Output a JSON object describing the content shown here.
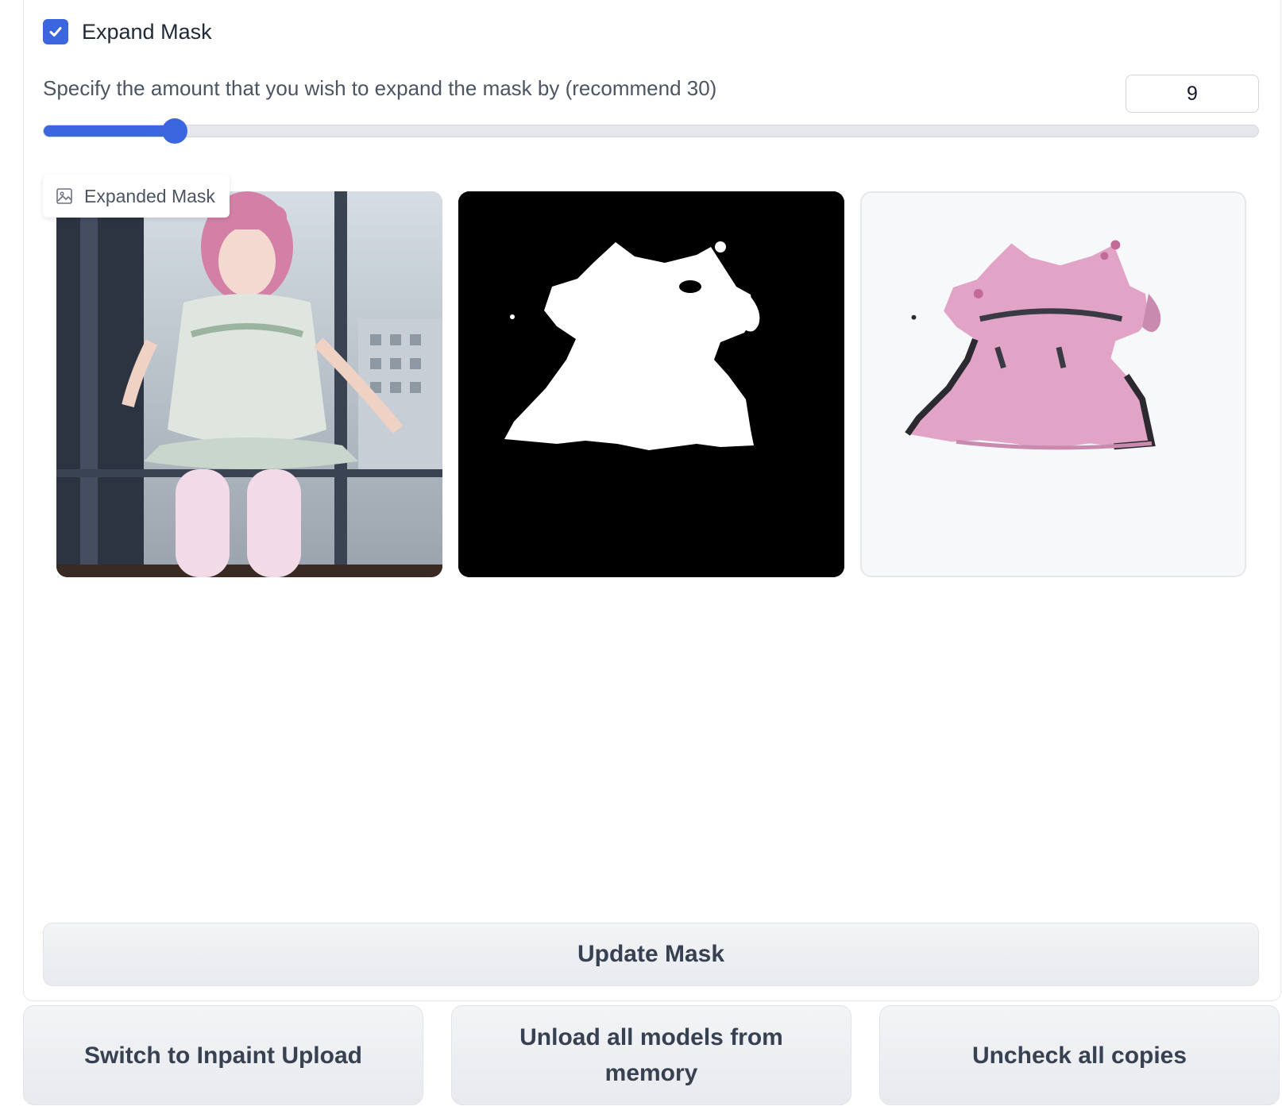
{
  "expand_mask": {
    "checkbox_label": "Expand Mask",
    "checked": true
  },
  "slider": {
    "label": "Specify the amount that you wish to expand the mask by (recommend 30)",
    "value": "9",
    "min": 0,
    "max": 100,
    "fill_fraction": 0.098
  },
  "gallery": {
    "label": "Expanded Mask",
    "items": [
      {
        "description_icon": "photo-original"
      },
      {
        "description_icon": "photo-mask"
      },
      {
        "description_icon": "photo-masked-dress"
      }
    ]
  },
  "buttons": {
    "update_mask": "Update Mask",
    "switch_inpaint": "Switch to Inpaint Upload",
    "unload_models": "Unload all models from memory",
    "uncheck_copies": "Uncheck all copies"
  },
  "colors": {
    "accent": "#3b66e0",
    "button_bg": "#eceef1",
    "button_text": "#374151",
    "dress_pink": "#e2a4c6"
  }
}
